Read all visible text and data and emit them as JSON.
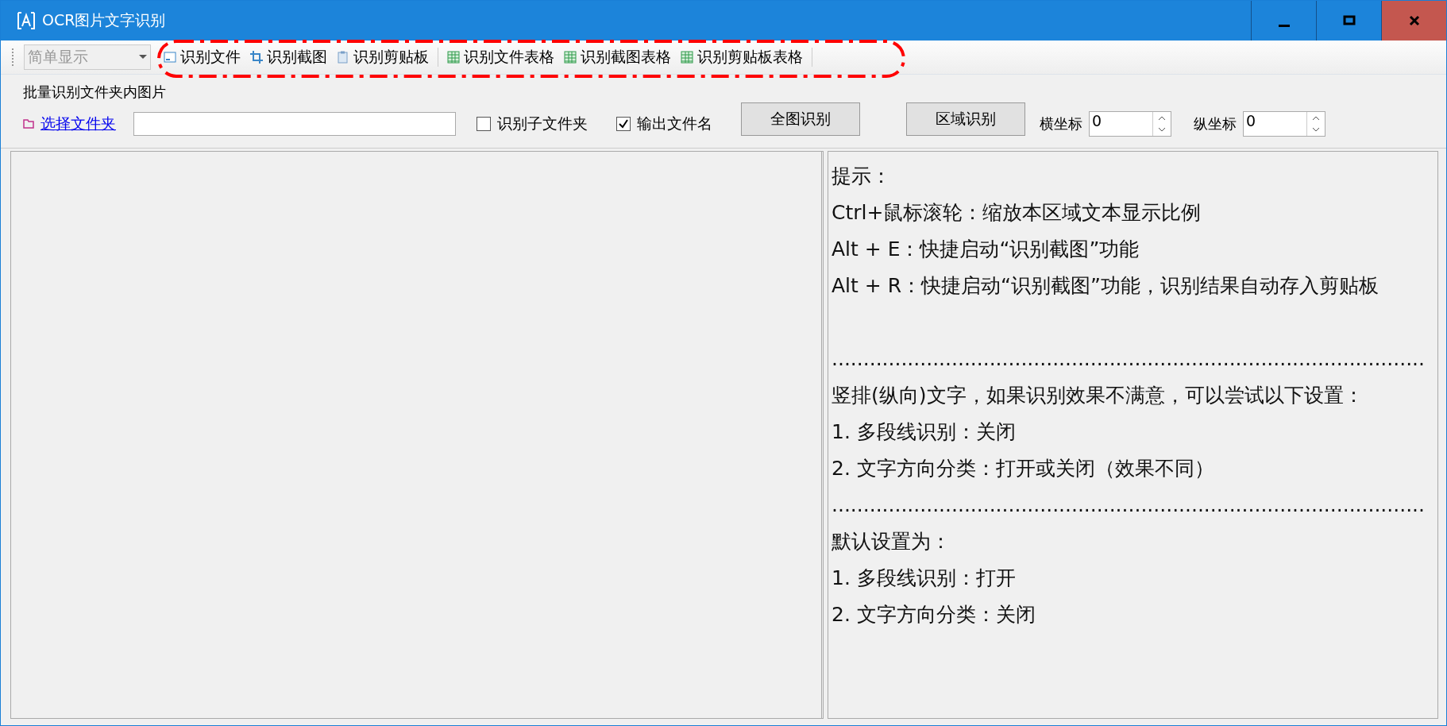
{
  "window": {
    "title": "OCR图片文字识别"
  },
  "toolbar": {
    "view_combo": {
      "value": "简单显示",
      "disabled": true
    },
    "button_groups": [
      [
        {
          "kind": "file",
          "label": "识别文件"
        },
        {
          "kind": "crop",
          "label": "识别截图"
        },
        {
          "kind": "clipboard",
          "label": "识别剪贴板"
        }
      ],
      [
        {
          "kind": "table",
          "label": "识别文件表格"
        },
        {
          "kind": "table",
          "label": "识别截图表格"
        },
        {
          "kind": "table",
          "label": "识别剪贴板表格"
        }
      ]
    ]
  },
  "batch": {
    "title": "批量识别文件夹内图片",
    "folder_link": "选择文件夹",
    "checkboxes": [
      {
        "label": "识别子文件夹",
        "checked": false
      },
      {
        "label": "输出文件名",
        "checked": true
      }
    ],
    "buttons": [
      "全图识别",
      "区域识别"
    ],
    "spinners": [
      {
        "label": "横坐标",
        "value": "0"
      },
      {
        "label": "纵坐标",
        "value": "0"
      }
    ]
  },
  "hint_sections": [
    [
      "提示：",
      "Ctrl+鼠标滚轮：缩放本区域文本显示比例",
      "Alt + E：快捷启动“识别截图”功能",
      "Alt + R：快捷启动“识别截图”功能，识别结果自动存入剪贴板"
    ],
    [
      "..............................................................................................",
      "竖排(纵向)文字，如果识别效果不满意，可以尝试以下设置：",
      "1. 多段线识别：关闭",
      "2. 文字方向分类：打开或关闭（效果不同）",
      "..............................................................................................",
      "默认设置为：",
      "1. 多段线识别：打开",
      "2. 文字方向分类：关闭"
    ]
  ]
}
